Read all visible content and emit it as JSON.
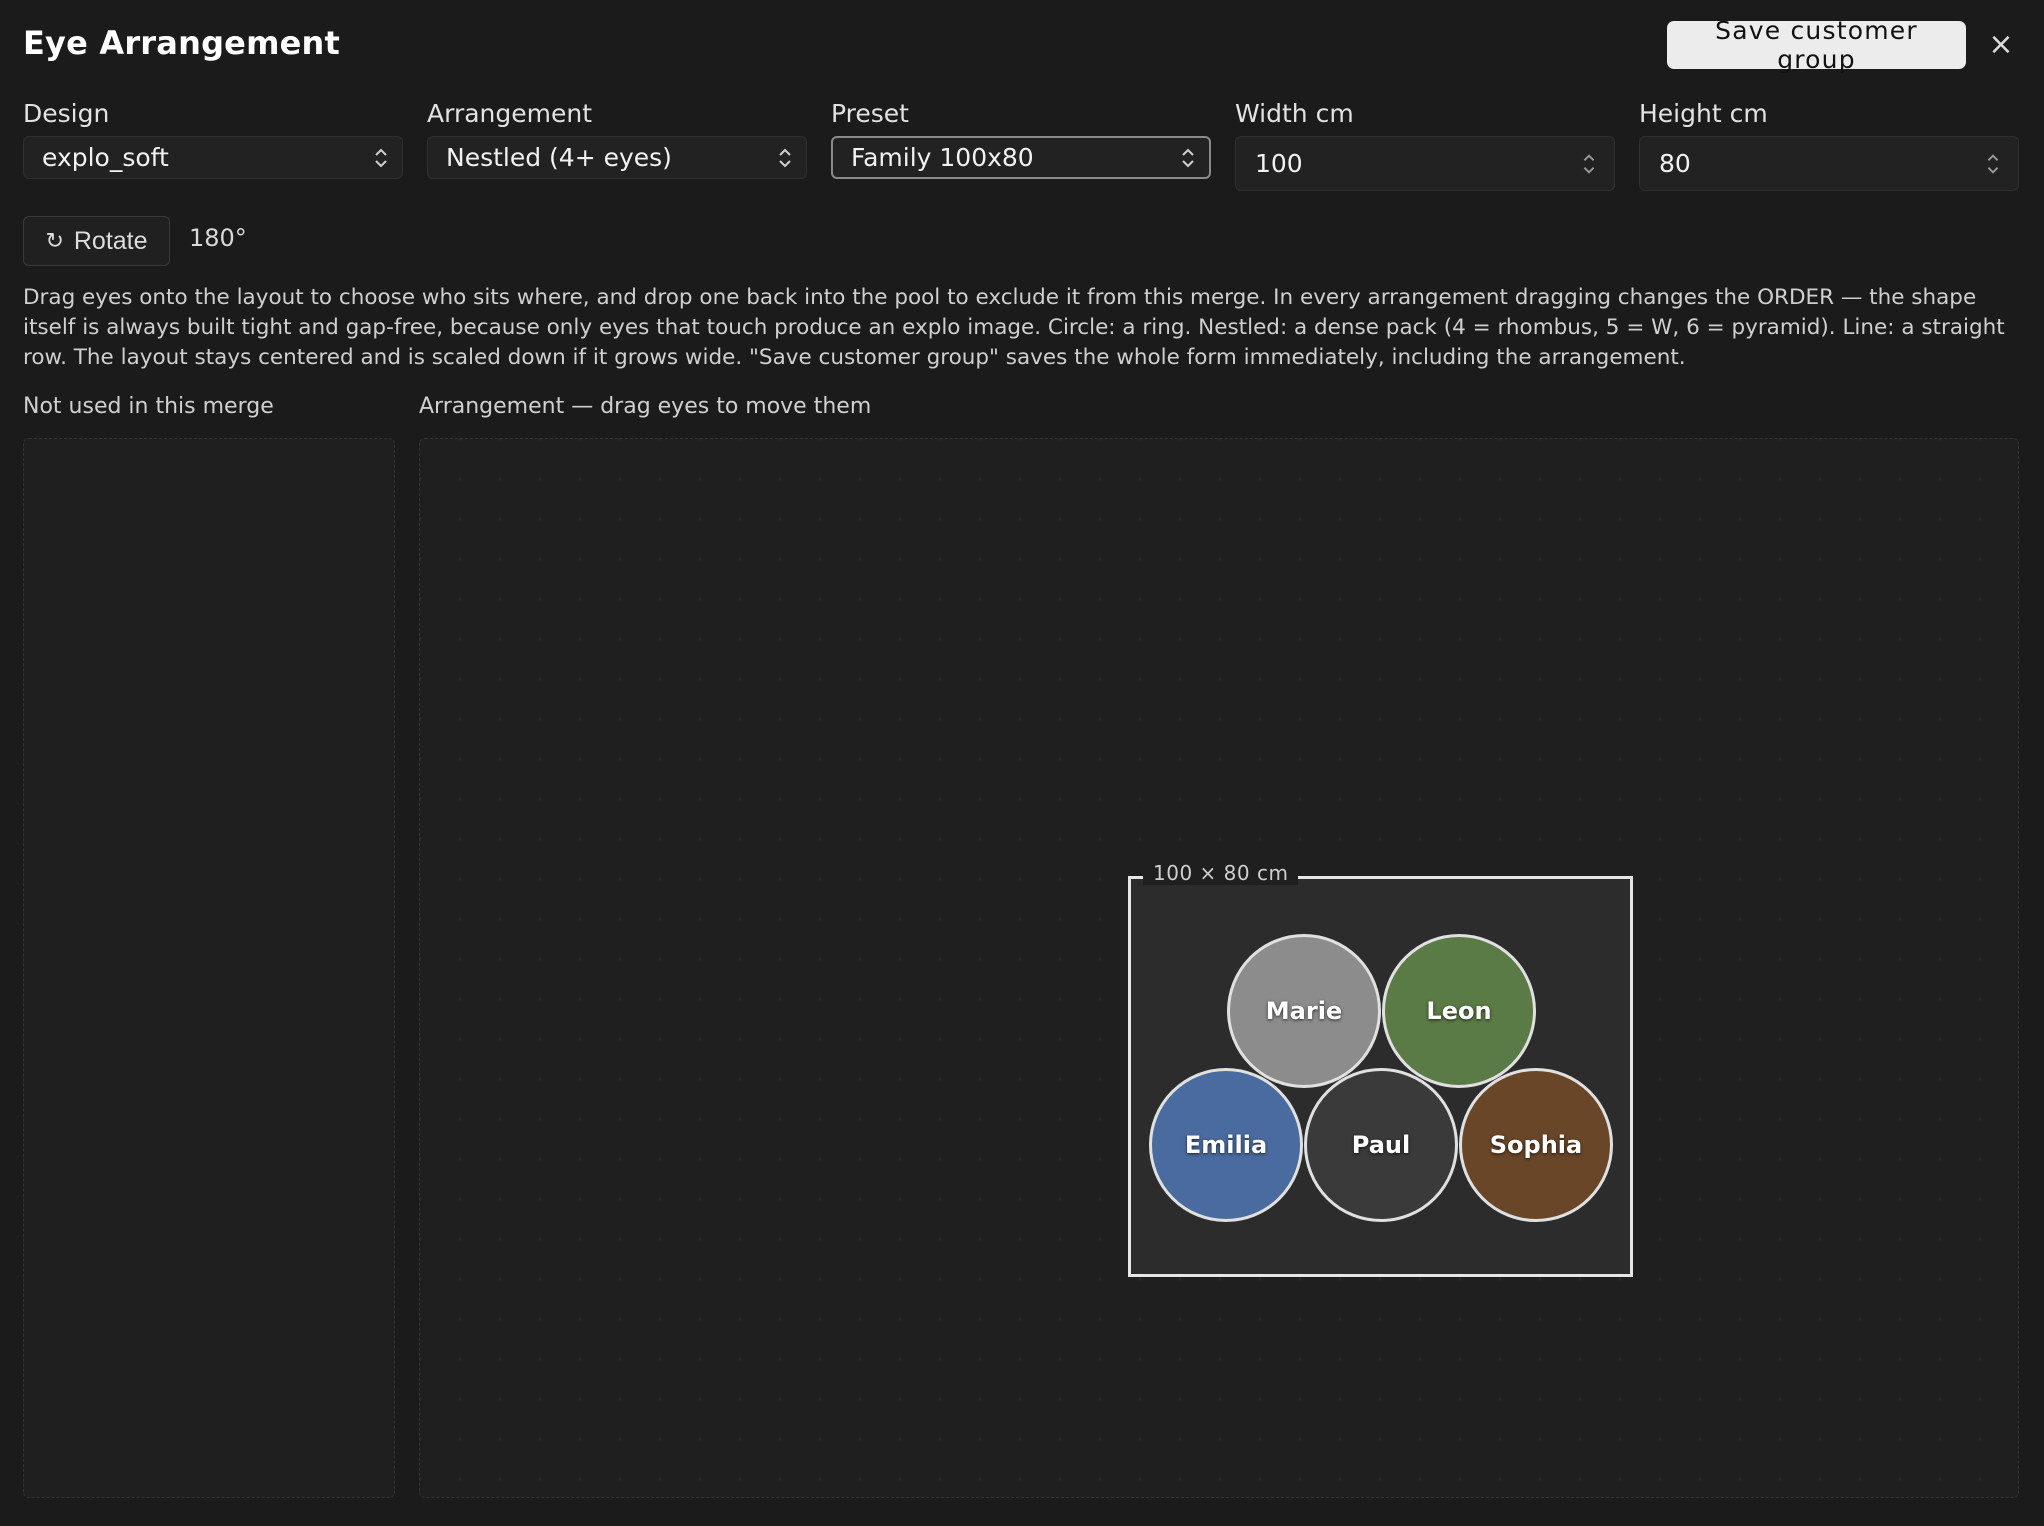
{
  "dialog": {
    "title": "Eye Arrangement",
    "save_label": "Save customer group",
    "close_label": "×"
  },
  "fields": {
    "design": {
      "label": "Design",
      "value": "explo_soft"
    },
    "arrangement": {
      "label": "Arrangement",
      "value": "Nestled (4+ eyes)"
    },
    "preset": {
      "label": "Preset",
      "value": "Family 100x80"
    },
    "width": {
      "label": "Width cm",
      "value": "100"
    },
    "height": {
      "label": "Height cm",
      "value": "80"
    }
  },
  "rotate": {
    "icon": "rotate-icon",
    "glyph": "↻",
    "label": "Rotate",
    "value": "180°"
  },
  "help_text": "Drag eyes onto the layout to choose who sits where, and drop one back into the pool to exclude it from this merge. In every arrangement dragging changes the ORDER — the shape itself is always built tight and gap-free, because only eyes that touch produce an explo image. Circle: a ring. Nestled: a dense pack (4 = rhombus, 5 = W, 6 = pyramid). Line: a straight row. The layout stays centered and is scaled down if it grows wide. \"Save customer group\" saves the whole form immediately, including the arrangement.",
  "pool": {
    "label": "Not used in this merge",
    "items": []
  },
  "stage": {
    "label": "Arrangement — drag eyes to move them",
    "canvas_label": "100 × 80 cm",
    "eyes": [
      {
        "name": "Marie",
        "color": "#8c8c8c"
      },
      {
        "name": "Leon",
        "color": "#5a7a46"
      },
      {
        "name": "Emilia",
        "color": "#4a6ba0"
      },
      {
        "name": "Paul",
        "color": "#3a3a3a"
      },
      {
        "name": "Sophia",
        "color": "#6a4629"
      }
    ]
  },
  "colors": {
    "background": "#1b1b1b",
    "save_button_bg": "#ececec",
    "canvas_border": "#e6e6e6"
  }
}
